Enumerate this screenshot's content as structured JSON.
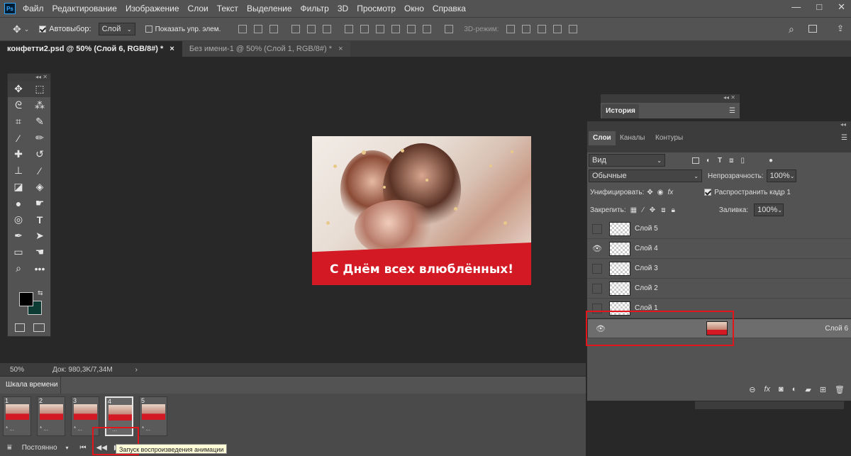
{
  "menubar": {
    "logo": "Ps",
    "items": [
      "Файл",
      "Редактирование",
      "Изображение",
      "Слои",
      "Текст",
      "Выделение",
      "Фильтр",
      "3D",
      "Просмотр",
      "Окно",
      "Справка"
    ],
    "window_controls": [
      "—",
      "□",
      "✕"
    ]
  },
  "options": {
    "autoselect_label": "Автовыбор:",
    "autoselect_value": "Слой",
    "show_controls_label": "Показать упр. элем.",
    "mode3d_label": "3D-режим:"
  },
  "tabs": [
    {
      "label": "конфетти2.psd @ 50% (Слой 6, RGB/8#) *",
      "close": "×"
    },
    {
      "label": "Без имени-1 @ 50% (Слой 1, RGB/8#) *",
      "close": "×"
    }
  ],
  "canvas": {
    "banner_text": "С Днём всех влюблённых!"
  },
  "status": {
    "zoom": "50%",
    "doc": "Док: 980,3K/7,34M",
    "arrow": "›"
  },
  "timeline": {
    "title": "Шкала времени",
    "frames": [
      {
        "num": "1",
        "duration": "* ..."
      },
      {
        "num": "2",
        "duration": "* ..."
      },
      {
        "num": "3",
        "duration": "* ..."
      },
      {
        "num": "4",
        "duration": "* ..."
      },
      {
        "num": "5",
        "duration": "* ..."
      }
    ],
    "loop": "Постоянно",
    "tooltip": "Запуск воспроизведения анимации"
  },
  "history": {
    "tab": "История"
  },
  "layers_panel": {
    "tabs": [
      "Слои",
      "Каналы",
      "Контуры"
    ],
    "filter": "Вид",
    "blend_mode": "Обычные",
    "opacity_label": "Непрозрачность:",
    "opacity_value": "100%",
    "unify_label": "Унифицировать:",
    "propagate_label": "Распространить кадр 1",
    "lock_label": "Закрепить:",
    "fill_label": "Заливка:",
    "fill_value": "100%",
    "layers": [
      {
        "name": "Слой 5",
        "visible": false
      },
      {
        "name": "Слой 4",
        "visible": true
      },
      {
        "name": "Слой 3",
        "visible": false
      },
      {
        "name": "Слой 2",
        "visible": false
      },
      {
        "name": "Слой 1",
        "visible": false
      },
      {
        "name": "Слой 6",
        "visible": true
      }
    ],
    "bottom_icons": [
      "link-icon",
      "fx-icon",
      "mask-icon",
      "adjustment-icon",
      "folder-icon",
      "new-layer-icon",
      "trash-icon"
    ]
  },
  "colors": {
    "highlight": "#e1161c",
    "banner": "#d31924",
    "bg_swatch": "#0c3b34"
  }
}
